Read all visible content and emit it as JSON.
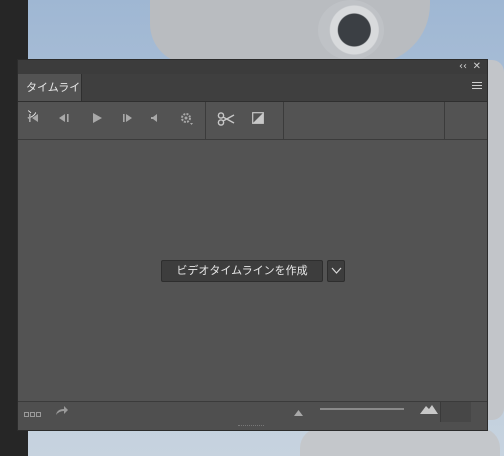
{
  "panel": {
    "collapse_glyph": "‹‹",
    "close_glyph": "✕"
  },
  "tabs": [
    {
      "label": "タイムライン"
    }
  ],
  "toolbar": {
    "buttons": [
      {
        "icon": "go-to-first-frame-icon"
      },
      {
        "icon": "previous-frame-icon"
      },
      {
        "icon": "play-icon"
      },
      {
        "icon": "next-frame-icon"
      },
      {
        "icon": "audio-icon"
      },
      {
        "icon": "settings-icon"
      },
      {
        "icon": "scissors-icon"
      },
      {
        "icon": "transition-icon"
      }
    ]
  },
  "main": {
    "create_button_label": "ビデオタイムラインを作成",
    "dropdown_icon": "chevron-down-icon"
  },
  "footer": {
    "icons": [
      "frame-mode-icon",
      "render-video-icon",
      "zoom-out-icon",
      "zoom-in-icon"
    ]
  },
  "colors": {
    "panel_bg": "#535353",
    "tabbar_bg": "#3f3f3f",
    "button_bg": "#3d3d3d"
  }
}
